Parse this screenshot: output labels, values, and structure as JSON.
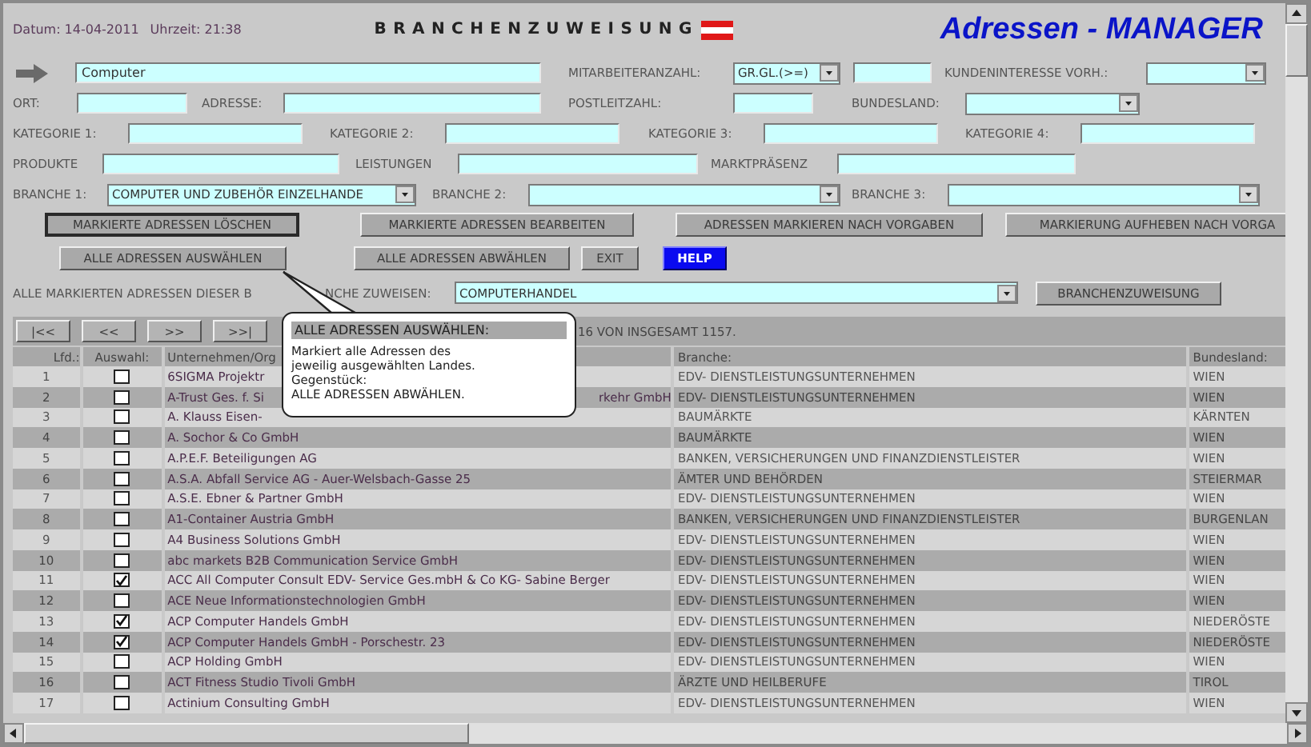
{
  "header": {
    "date": "Datum: 14-04-2011",
    "time": "Uhrzeit: 21:38",
    "title": "BRANCHENZUWEISUNG",
    "app_title": "Adressen - MANAGER"
  },
  "filter_rows": [
    [
      {
        "kind": "input",
        "value": "Computer"
      },
      {
        "kind": "label",
        "text": "MITARBEITERANZAHL:"
      },
      {
        "kind": "select",
        "value": "GR.GL.(>=)"
      },
      {
        "kind": "input"
      },
      {
        "kind": "label",
        "text": "KUNDENINTERESSE VORH.:"
      },
      {
        "kind": "select"
      }
    ],
    [
      {
        "kind": "label",
        "text": "ORT:"
      },
      {
        "kind": "input"
      },
      {
        "kind": "label",
        "text": "ADRESSE:"
      },
      {
        "kind": "input"
      },
      {
        "kind": "label",
        "text": "POSTLEITZAHL:"
      },
      {
        "kind": "input"
      },
      {
        "kind": "label",
        "text": "BUNDESLAND:"
      },
      {
        "kind": "select"
      }
    ],
    [
      {
        "kind": "label",
        "text": "KATEGORIE 1:"
      },
      {
        "kind": "input"
      },
      {
        "kind": "label",
        "text": "KATEGORIE 2:"
      },
      {
        "kind": "input"
      },
      {
        "kind": "label",
        "text": "KATEGORIE 3:"
      },
      {
        "kind": "input"
      },
      {
        "kind": "label",
        "text": "KATEGORIE 4:"
      },
      {
        "kind": "input"
      }
    ],
    [
      {
        "kind": "label",
        "text": "PRODUKTE"
      },
      {
        "kind": "input"
      },
      {
        "kind": "label",
        "text": "LEISTUNGEN"
      },
      {
        "kind": "input"
      },
      {
        "kind": "label",
        "text": "MARKTPRÄSENZ"
      },
      {
        "kind": "input"
      }
    ],
    [
      {
        "kind": "label",
        "text": "BRANCHE 1:"
      },
      {
        "kind": "select",
        "value": "COMPUTER UND ZUBEHÖR EINZELHANDE"
      },
      {
        "kind": "label",
        "text": "BRANCHE 2:"
      },
      {
        "kind": "select"
      },
      {
        "kind": "label",
        "text": "BRANCHE 3:"
      },
      {
        "kind": "select"
      }
    ]
  ],
  "action_buttons": [
    [
      {
        "label": "MARKIERTE ADRESSEN LÖSCHEN",
        "kind": "normal",
        "focused": true
      },
      {
        "label": "MARKIERTE ADRESSEN BEARBEITEN",
        "kind": "normal",
        "focused": false
      },
      {
        "label": "ADRESSEN MARKIEREN NACH VORGABEN",
        "kind": "normal",
        "focused": false
      },
      {
        "label": "MARKIERUNG AUFHEBEN NACH VORGA",
        "kind": "normal",
        "focused": false
      }
    ],
    [
      {
        "label": "ALLE ADRESSEN AUSWÄHLEN",
        "kind": "normal",
        "focused": false
      },
      {
        "label": "ALLE ADRESSEN ABWÄHLEN",
        "kind": "normal",
        "focused": false
      },
      {
        "label": "EXIT",
        "kind": "normal",
        "focused": false
      },
      {
        "label": "HELP",
        "kind": "help",
        "focused": false
      }
    ]
  ],
  "assign": {
    "label": "ALLE MARKIERTEN ADRESSEN DIESER B",
    "label_end": "NCHE ZUWEISEN:",
    "select_value": "COMPUTERHANDEL",
    "button": "BRANCHENZUWEISUNG"
  },
  "pager": {
    "buttons": [
      "|<<",
      "<<",
      ">>",
      ">>|"
    ],
    "info": "16 VON INSGESAMT 1157."
  },
  "table": {
    "columns": [
      "Lfd.:",
      "Auswahl:",
      "Unternehmen/Org",
      "Branche:",
      "Bundesland:"
    ],
    "rows": [
      {
        "index": "1",
        "checked": false,
        "company": "6SIGMA Projektr",
        "branche": "EDV- DIENSTLEISTUNGSUNTERNEHMEN",
        "bundesland": "WIEN"
      },
      {
        "index": "2",
        "checked": false,
        "company": "A-Trust Ges. f. Si",
        "company_end": "rkehr GmbH",
        "branche": "EDV- DIENSTLEISTUNGSUNTERNEHMEN",
        "bundesland": "WIEN"
      },
      {
        "index": "3",
        "checked": false,
        "company": "A. Klauss Eisen-",
        "branche": "BAUMÄRKTE",
        "bundesland": "KÄRNTEN"
      },
      {
        "index": "4",
        "checked": false,
        "company": "A. Sochor & Co GmbH",
        "branche": "BAUMÄRKTE",
        "bundesland": "WIEN"
      },
      {
        "index": "5",
        "checked": false,
        "company": "A.P.E.F. Beteiligungen AG",
        "branche": "BANKEN, VERSICHERUNGEN UND FINANZDIENSTLEISTER",
        "bundesland": "WIEN"
      },
      {
        "index": "6",
        "checked": false,
        "company": "A.S.A. Abfall Service AG - Auer-Welsbach-Gasse 25",
        "branche": "ÄMTER UND BEHÖRDEN",
        "bundesland": "STEIERMAR"
      },
      {
        "index": "7",
        "checked": false,
        "company": "A.S.E. Ebner & Partner GmbH",
        "branche": "EDV- DIENSTLEISTUNGSUNTERNEHMEN",
        "bundesland": "WIEN"
      },
      {
        "index": "8",
        "checked": false,
        "company": "A1-Container Austria GmbH",
        "branche": "BANKEN, VERSICHERUNGEN UND FINANZDIENSTLEISTER",
        "bundesland": "BURGENLAN"
      },
      {
        "index": "9",
        "checked": false,
        "company": "A4 Business Solutions GmbH",
        "branche": "EDV- DIENSTLEISTUNGSUNTERNEHMEN",
        "bundesland": "WIEN"
      },
      {
        "index": "10",
        "checked": false,
        "company": "abc markets B2B Communication Service GmbH",
        "branche": "EDV- DIENSTLEISTUNGSUNTERNEHMEN",
        "bundesland": "WIEN"
      },
      {
        "index": "11",
        "checked": true,
        "company": "ACC All Computer Consult EDV- Service Ges.mbH & Co KG- Sabine Berger",
        "branche": "EDV- DIENSTLEISTUNGSUNTERNEHMEN",
        "bundesland": "WIEN"
      },
      {
        "index": "12",
        "checked": false,
        "company": "ACE Neue Informationstechnologien GmbH",
        "branche": "EDV- DIENSTLEISTUNGSUNTERNEHMEN",
        "bundesland": "WIEN"
      },
      {
        "index": "13",
        "checked": true,
        "company": "ACP Computer Handels GmbH",
        "branche": "EDV- DIENSTLEISTUNGSUNTERNEHMEN",
        "bundesland": "NIEDERÖSTE"
      },
      {
        "index": "14",
        "checked": true,
        "company": "ACP Computer Handels GmbH - Porschestr. 23",
        "branche": "EDV- DIENSTLEISTUNGSUNTERNEHMEN",
        "bundesland": "NIEDERÖSTE"
      },
      {
        "index": "15",
        "checked": false,
        "company": "ACP Holding GmbH",
        "branche": "EDV- DIENSTLEISTUNGSUNTERNEHMEN",
        "bundesland": "WIEN"
      },
      {
        "index": "16",
        "checked": false,
        "company": "ACT Fitness Studio Tivoli GmbH",
        "branche": "ÄRZTE UND HEILBERUFE",
        "bundesland": "TIROL"
      },
      {
        "index": "17",
        "checked": false,
        "company": "Actinium Consulting GmbH",
        "branche": "EDV- DIENSTLEISTUNGSUNTERNEHMEN",
        "bundesland": "WIEN"
      }
    ]
  },
  "tooltip": {
    "title": "ALLE ADRESSEN AUSWÄHLEN:",
    "text": "Markiert alle Adressen des\njeweilig ausgewählten Landes.\nGegenstück:\nALLE ADRESSEN ABWÄHLEN."
  }
}
